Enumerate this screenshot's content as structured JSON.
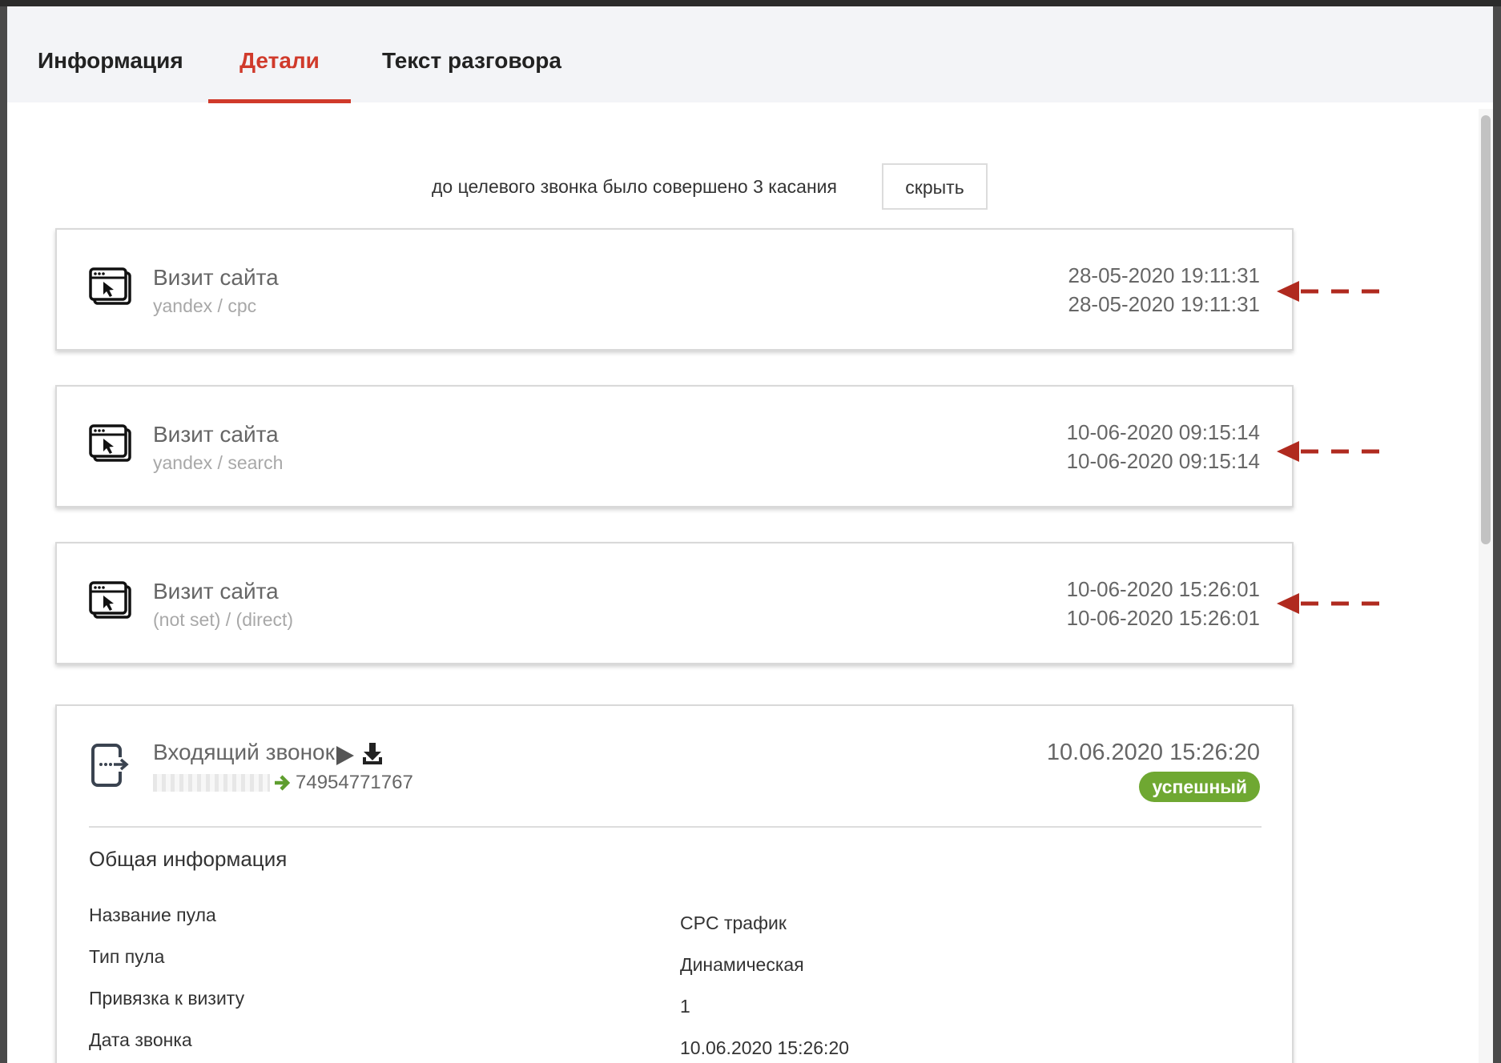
{
  "tabs": [
    {
      "label": "Информация",
      "active": false
    },
    {
      "label": "Детали",
      "active": true
    },
    {
      "label": "Текст разговора",
      "active": false
    }
  ],
  "summary": {
    "text": "до целевого звонка было совершено 3 касания",
    "hide_button": "скрыть"
  },
  "visits": [
    {
      "title": "Визит сайта",
      "source": "yandex / cpc",
      "date_start": "28-05-2020 19:11:31",
      "date_end": "28-05-2020 19:11:31"
    },
    {
      "title": "Визит сайта",
      "source": "yandex / search",
      "date_start": "10-06-2020 09:15:14",
      "date_end": "10-06-2020 09:15:14"
    },
    {
      "title": "Визит сайта",
      "source": "(not set) / (direct)",
      "date_start": "10-06-2020 15:26:01",
      "date_end": "10-06-2020 15:26:01"
    }
  ],
  "call": {
    "title": "Входящий звонок",
    "callee": "74954771767",
    "date": "10.06.2020 15:26:20",
    "status": "успешный",
    "section_title": "Общая информация",
    "fields": [
      {
        "label": "Название пула",
        "value": "CPC трафик"
      },
      {
        "label": "Тип пула",
        "value": "Динамическая"
      },
      {
        "label": "Привязка к визиту",
        "value": "1"
      },
      {
        "label": "Дата звонка",
        "value": "10.06.2020 15:26:20"
      }
    ]
  },
  "colors": {
    "accent": "#d03a2b",
    "status_success": "#6fa832",
    "annotation_arrow": "#b02a1f"
  },
  "icons": {
    "visit": "browser-click-icon",
    "call": "incoming-call-icon",
    "play": "play-icon",
    "download": "download-icon",
    "route": "arrow-right-icon"
  }
}
